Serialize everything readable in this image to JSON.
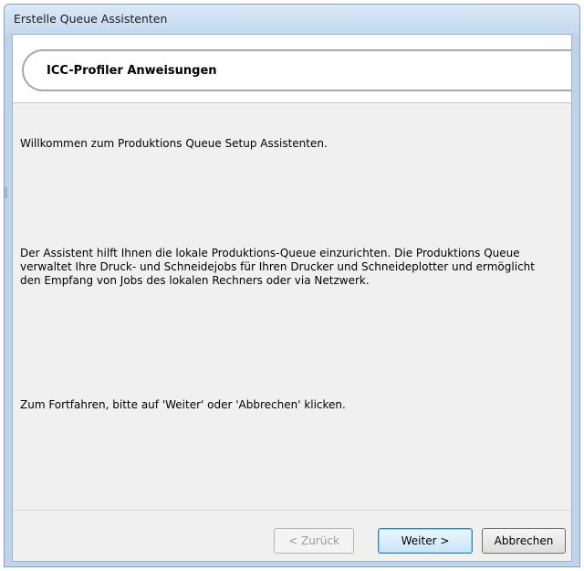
{
  "window": {
    "title": "Erstelle Queue Assistenten"
  },
  "header": {
    "title": "ICC-Profiler Anweisungen"
  },
  "content": {
    "welcome": "Willkommen zum Produktions Queue Setup Assistenten.",
    "description": "Der Assistent hilft Ihnen die lokale Produktions-Queue einzurichten. Die Produktions Queue verwaltet Ihre Druck- und Schneidejobs für Ihren Drucker und Schneideplotter und ermöglicht den Empfang von Jobs des lokalen Rechners oder via Netzwerk.",
    "instruction": "Zum Fortfahren, bitte auf 'Weiter' oder 'Abbrechen' klicken."
  },
  "buttons": {
    "back": "< Zurück",
    "next": "Weiter >",
    "cancel": "Abbrechen"
  }
}
